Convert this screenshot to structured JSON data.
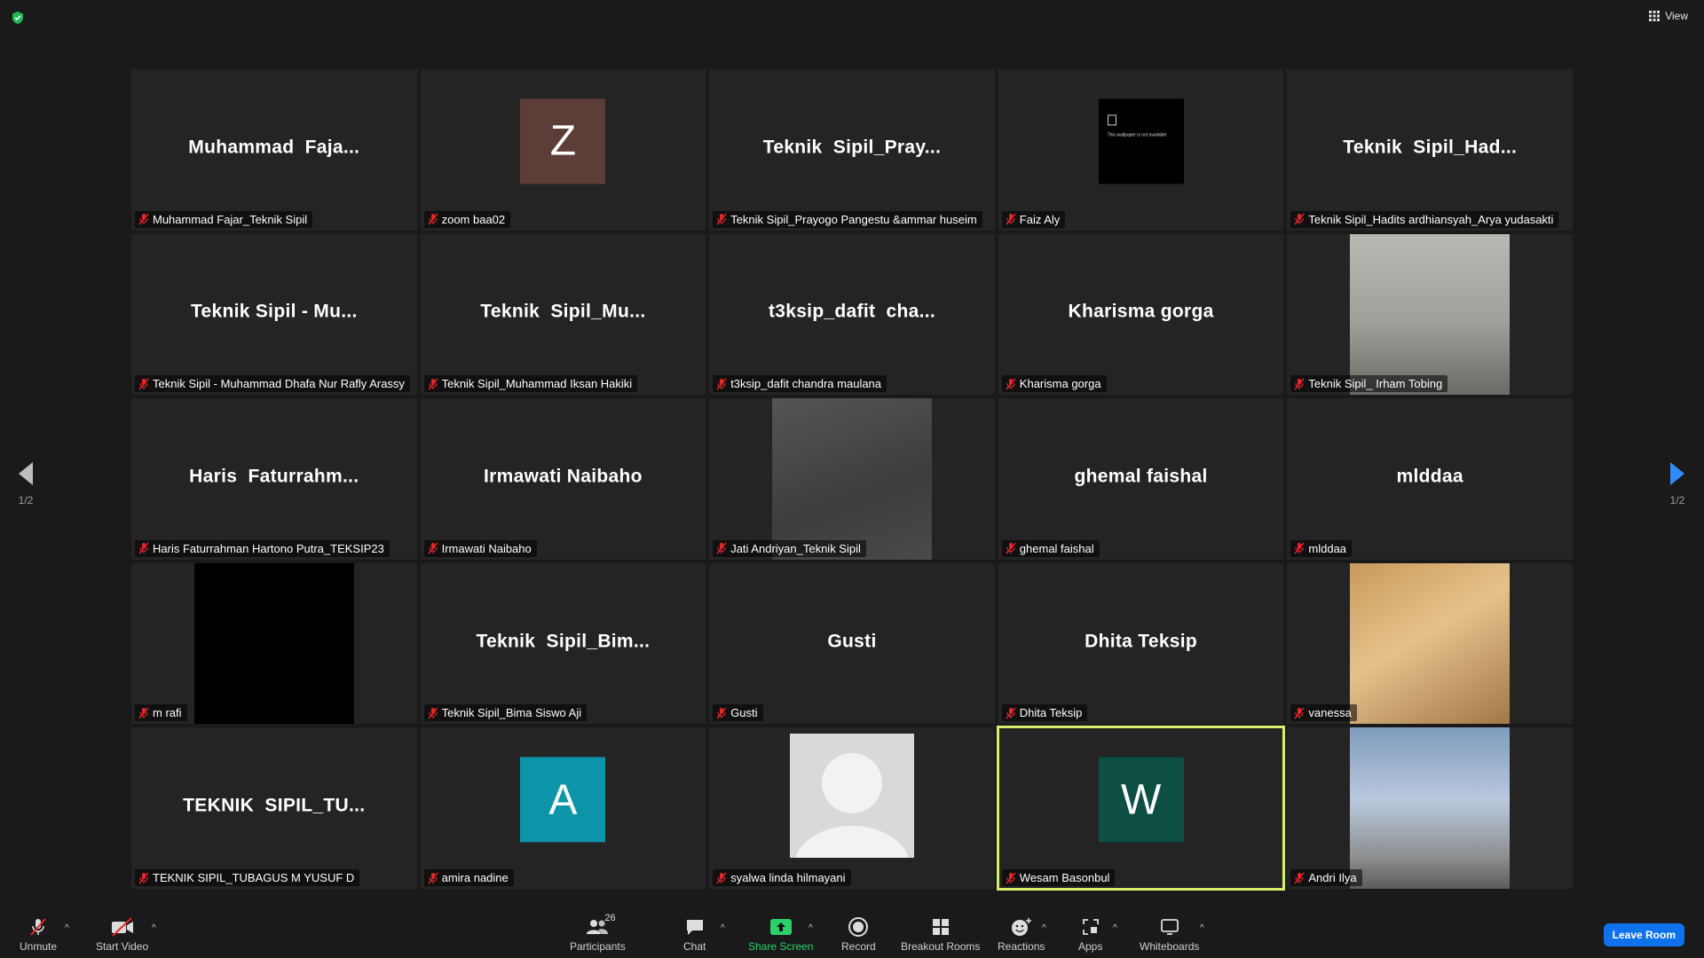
{
  "topbar": {
    "view_label": "View"
  },
  "pagination": {
    "left_page": "1/2",
    "right_page": "1/2"
  },
  "tiles": [
    {
      "display": "Muhammad  Faja...",
      "label": "Muhammad Fajar_Teknik Sipil"
    },
    {
      "avatar_letter": "Z",
      "avatar_color": "#5c3d37",
      "label": "zoom baa02"
    },
    {
      "display": "Teknik  Sipil_Pray...",
      "label": "Teknik Sipil_Prayogo Pangestu &ammar huseim"
    },
    {
      "wallpaper_text": "This wallpaper is not available",
      "label": "Faiz Aly"
    },
    {
      "display": "Teknik  Sipil_Had...",
      "label": "Teknik Sipil_Hadits ardhiansyah_Arya yudasakti"
    },
    {
      "display": "Teknik Sipil - Mu...",
      "label": "Teknik Sipil - Muhammad Dhafa Nur Rafly Arassy"
    },
    {
      "display": "Teknik  Sipil_Mu...",
      "label": "Teknik Sipil_Muhammad Iksan Hakiki"
    },
    {
      "display": "t3ksip_dafit  cha...",
      "label": "t3ksip_dafit chandra maulana"
    },
    {
      "display": "Kharisma gorga",
      "label": "Kharisma gorga"
    },
    {
      "video": "person-legs",
      "label": "Teknik Sipil_ Irham Tobing"
    },
    {
      "display": "Haris  Faturrahm...",
      "label": "Haris Faturrahman Hartono Putra_TEKSIP23"
    },
    {
      "display": "Irmawati Naibaho",
      "label": "Irmawati Naibaho"
    },
    {
      "video": "grey",
      "label": "Jati Andriyan_Teknik Sipil"
    },
    {
      "display": "ghemal faishal",
      "label": "ghemal faishal"
    },
    {
      "display": "mlddaa",
      "label": "mlddaa"
    },
    {
      "video": "black",
      "label": "m rafi"
    },
    {
      "display": "Teknik  Sipil_Bim...",
      "label": "Teknik Sipil_Bima Siswo Aji"
    },
    {
      "display": "Gusti",
      "label": "Gusti"
    },
    {
      "display": "Dhita Teksip",
      "label": "Dhita Teksip"
    },
    {
      "video": "kitchen",
      "label": "vanessa"
    },
    {
      "display": "TEKNIK  SIPIL_TU...",
      "label": "TEKNIK SIPIL_TUBAGUS M YUSUF D"
    },
    {
      "avatar_letter": "A",
      "avatar_color": "#0e94a8",
      "label": "amira nadine"
    },
    {
      "default_avatar": true,
      "label": "syalwa linda hilmayani"
    },
    {
      "avatar_letter": "W",
      "avatar_color": "#0d4f42",
      "label": "Wesam Basonbul",
      "active": true
    },
    {
      "video": "sky",
      "label": "Andri Ilya"
    }
  ],
  "toolbar": {
    "unmute": "Unmute",
    "start_video": "Start Video",
    "participants": "Participants",
    "participants_count": "26",
    "chat": "Chat",
    "share_screen": "Share Screen",
    "record": "Record",
    "breakout_rooms": "Breakout Rooms",
    "reactions": "Reactions",
    "apps": "Apps",
    "whiteboards": "Whiteboards",
    "leave": "Leave Room"
  },
  "colors": {
    "active_speaker": "#d7ee6a",
    "share_green": "#2bd16a",
    "leave_blue": "#0e72ed",
    "mic_off_red": "#e02828"
  }
}
